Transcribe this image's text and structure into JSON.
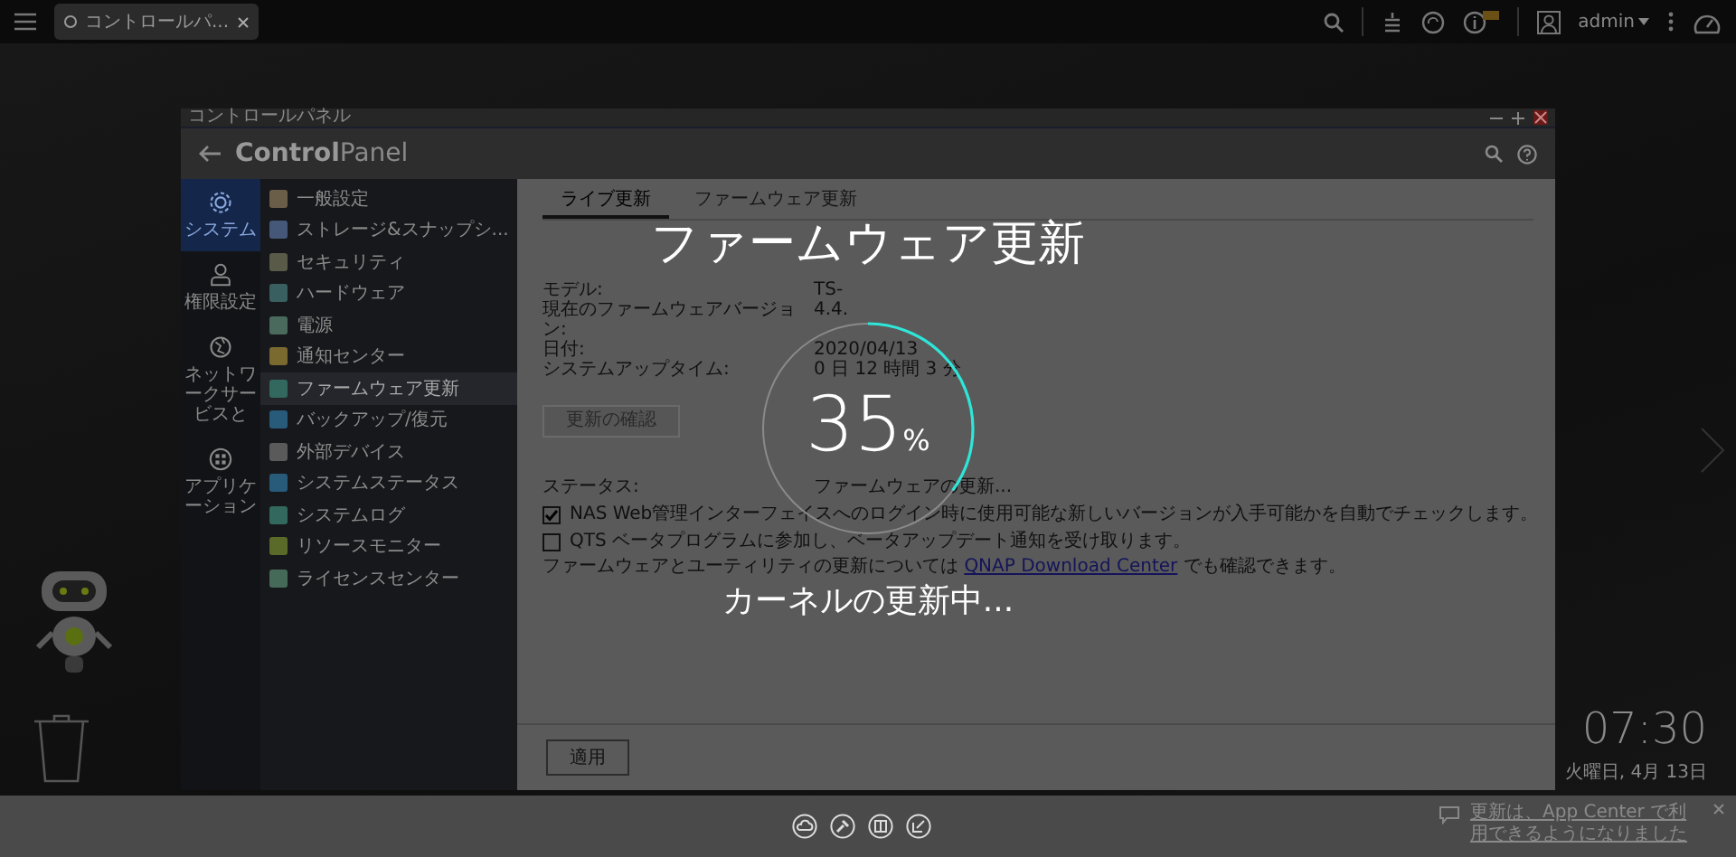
{
  "taskbar": {
    "tab": {
      "label": "コントロールパ..."
    },
    "user": "admin"
  },
  "window": {
    "title": "コントロールパネル",
    "app_title": "**Control**Panel"
  },
  "nav": [
    {
      "label": "システム",
      "selected": true,
      "kind": "gear"
    },
    {
      "label": "権限設定",
      "selected": false,
      "kind": "user"
    },
    {
      "label": "ネットワークサービスと",
      "selected": false,
      "kind": "globe"
    },
    {
      "label": "アプリケーション",
      "selected": false,
      "kind": "apps"
    }
  ],
  "menu": [
    {
      "label": "一般設定",
      "selected": false
    },
    {
      "label": "ストレージ&スナップシ...",
      "selected": false
    },
    {
      "label": "セキュリティ",
      "selected": false
    },
    {
      "label": "ハードウェア",
      "selected": false
    },
    {
      "label": "電源",
      "selected": false
    },
    {
      "label": "通知センター",
      "selected": false
    },
    {
      "label": "ファームウェア更新",
      "selected": true
    },
    {
      "label": "バックアップ/復元",
      "selected": false
    },
    {
      "label": "外部デバイス",
      "selected": false
    },
    {
      "label": "システムステータス",
      "selected": false
    },
    {
      "label": "システムログ",
      "selected": false
    },
    {
      "label": "リソースモニター",
      "selected": false
    },
    {
      "label": "ライセンスセンター",
      "selected": false
    }
  ],
  "tabs": [
    {
      "label": "ライブ更新",
      "selected": true
    },
    {
      "label": "ファームウェア更新",
      "selected": false
    }
  ],
  "info": [
    {
      "label": "モデル:",
      "value": "TS-"
    },
    {
      "label": "現在のファームウェアバージョン:",
      "value": "4.4."
    },
    {
      "label": "日付:",
      "value": "2020/04/13"
    },
    {
      "label": "システムアップタイム:",
      "value": "0 日 12 時間 3 分"
    },
    {
      "label": "ステータス:",
      "value": "ファームウェアの更新..."
    }
  ],
  "check_button": {
    "label": "更新の確認",
    "disabled": true
  },
  "options": [
    {
      "label": "NAS Web管理インターフェイスへのログイン時に使用可能な新しいバージョンが入手可能かを自動でチェックします。",
      "checked": true
    },
    {
      "label": "QTS ベータプログラムに参加し、ベータアップデート通知を受け取ります。",
      "checked": false
    }
  ],
  "note": {
    "before": "ファームウェアとユーティリティの更新については",
    "link": "QNAP Download Center",
    "after": "でも確認できます。"
  },
  "apply_button": "適用",
  "progress": {
    "title": "ファームウェア更新",
    "percent": "35",
    "unit": "%",
    "level": 0.35,
    "message": "カーネルの更新中..."
  },
  "clock": {
    "time": "07:30",
    "date": "火曜日, 4月 13日"
  },
  "notification": {
    "text": "更新は、App Center で利用できるようになりました"
  }
}
